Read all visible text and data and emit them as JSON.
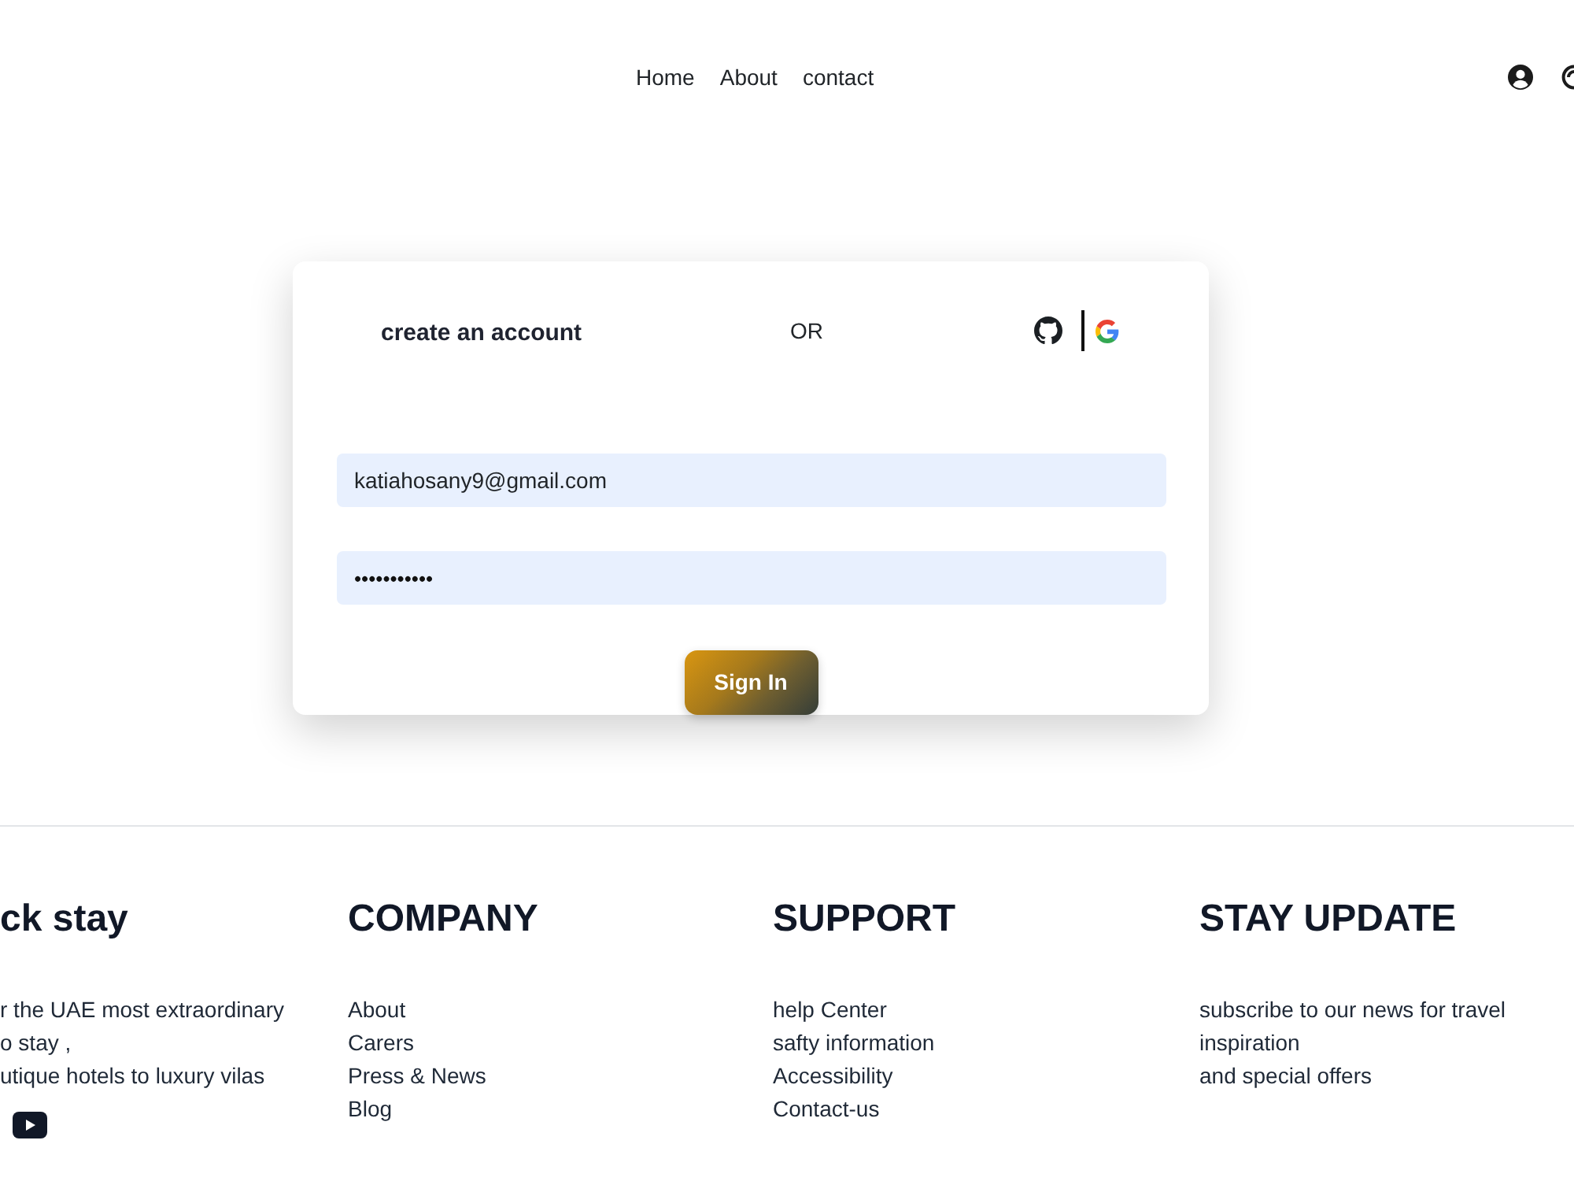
{
  "nav": {
    "links": [
      "Home",
      "About",
      "contact"
    ]
  },
  "login_card": {
    "title": "create an account",
    "separator": "OR",
    "email": {
      "value": "katiahosany9@gmail.com"
    },
    "password": {
      "value": "•••••••••••"
    },
    "submit_button": "Sign In"
  },
  "footer": {
    "columns": [
      {
        "kind": "about",
        "heading": "ck stay",
        "text": "r the UAE most extraordinary\no stay ,\nutique hotels to luxury vilas"
      },
      {
        "kind": "links",
        "heading": "COMPANY",
        "links": [
          "About",
          "Carers",
          "Press & News",
          "Blog"
        ]
      },
      {
        "kind": "links",
        "heading": "SUPPORT",
        "links": [
          "help Center",
          "safty information",
          "Accessibility",
          "Contact-us"
        ]
      },
      {
        "kind": "text",
        "heading": "STAY UPDATE",
        "text": "subscribe to our news for travel\ninspiration\nand special offers"
      }
    ]
  }
}
